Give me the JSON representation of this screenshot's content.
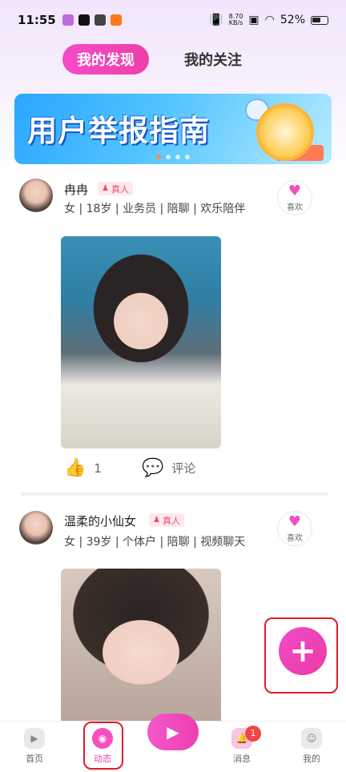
{
  "status_bar": {
    "time": "11:55",
    "netspeed_value": "8.70",
    "netspeed_unit": "KB/s",
    "battery": "52%"
  },
  "tabs": [
    {
      "label": "我的发现",
      "active": true
    },
    {
      "label": "我的关注",
      "active": false
    }
  ],
  "banner": {
    "text": "用户举报指南",
    "dots": 4,
    "active_dot": 0
  },
  "posts": [
    {
      "username": "冉冉",
      "badge": "真人",
      "tags": "女 | 18岁 | 业务员 | 陪聊 | 欢乐陪伴",
      "like_label": "喜欢",
      "likes": "1",
      "comment_label": "评论"
    },
    {
      "username": "温柔的小仙女",
      "badge": "真人",
      "tags": "女 | 39岁 | 个体户 | 陪聊 | 视频聊天",
      "like_label": "喜欢"
    }
  ],
  "fab": {
    "label": "+"
  },
  "bottom_nav": [
    {
      "label": "首页",
      "icon": "play-icon",
      "active": false
    },
    {
      "label": "动态",
      "icon": "compass-icon",
      "active": true
    },
    {
      "label": "",
      "icon": "video-icon",
      "active": false
    },
    {
      "label": "消息",
      "icon": "bell-icon",
      "active": false,
      "badge": "1"
    },
    {
      "label": "我的",
      "icon": "profile-icon",
      "active": false
    }
  ],
  "colors": {
    "accent": "#ef3ea9",
    "highlight_box": "#e11b2a"
  }
}
